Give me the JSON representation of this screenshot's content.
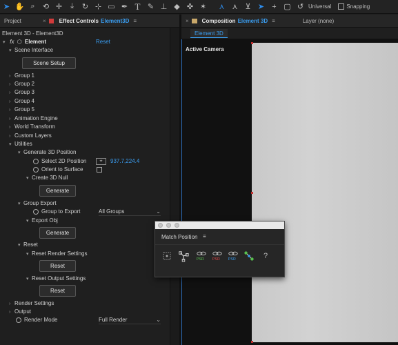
{
  "toolbar": {
    "universal_label": "Universal",
    "snapping_label": "Snapping",
    "icons": [
      "selection-icon",
      "hand-icon",
      "zoom-icon",
      "orbit-icon",
      "pan-icon",
      "dolly-icon",
      "rotate-icon",
      "region-icon",
      "pen-icon",
      "type-icon",
      "brush-icon",
      "clone-icon",
      "eraser-icon",
      "roto-icon",
      "puppet-icon",
      "axis-icon",
      "select-icon",
      "add-icon",
      "bounds-icon",
      "undo-icon"
    ]
  },
  "left_tabs": {
    "project": "Project",
    "effect_controls_prefix": "Effect Controls",
    "effect_controls_layer": "Element3D"
  },
  "breadcrumb": "Element 3D - Element3D",
  "effect": {
    "fx": "fx",
    "name": "Element",
    "reset": "Reset"
  },
  "tree": {
    "scene_interface": "Scene Interface",
    "scene_setup": "Scene Setup",
    "group1": "Group 1",
    "group2": "Group 2",
    "group3": "Group 3",
    "group4": "Group 4",
    "group5": "Group 5",
    "animation_engine": "Animation Engine",
    "world_transform": "World Transform",
    "custom_layers": "Custom Layers",
    "utilities": "Utilities",
    "generate_3d_position": "Generate 3D Position",
    "select_2d_position": "Select 2D Position",
    "position_value": "937.7,224.4",
    "orient_to_surface": "Orient to Surface",
    "create_3d_null": "Create 3D Null",
    "generate": "Generate",
    "group_export": "Group Export",
    "group_to_export": "Group to Export",
    "group_to_export_value": "All Groups",
    "export_obj": "Export Obj",
    "reset_section": "Reset",
    "reset_render_settings": "Reset Render Settings",
    "reset": "Reset",
    "reset_output_settings": "Reset Output Settings",
    "render_settings": "Render Settings",
    "output": "Output",
    "render_mode": "Render Mode",
    "render_mode_value": "Full Render"
  },
  "right_tabs": {
    "composition_prefix": "Composition",
    "composition_name": "Element 3D",
    "layer": "Layer (none)"
  },
  "sub_tab": "Element 3D",
  "viewer": {
    "active_camera": "Active Camera"
  },
  "match_position": {
    "title": "Match Position",
    "labels": [
      "PSR",
      "PSR",
      "PSR",
      "?"
    ]
  },
  "colors": {
    "accent": "#3a9df0",
    "canvas": "#cccccc",
    "red": "#d23b3b"
  }
}
